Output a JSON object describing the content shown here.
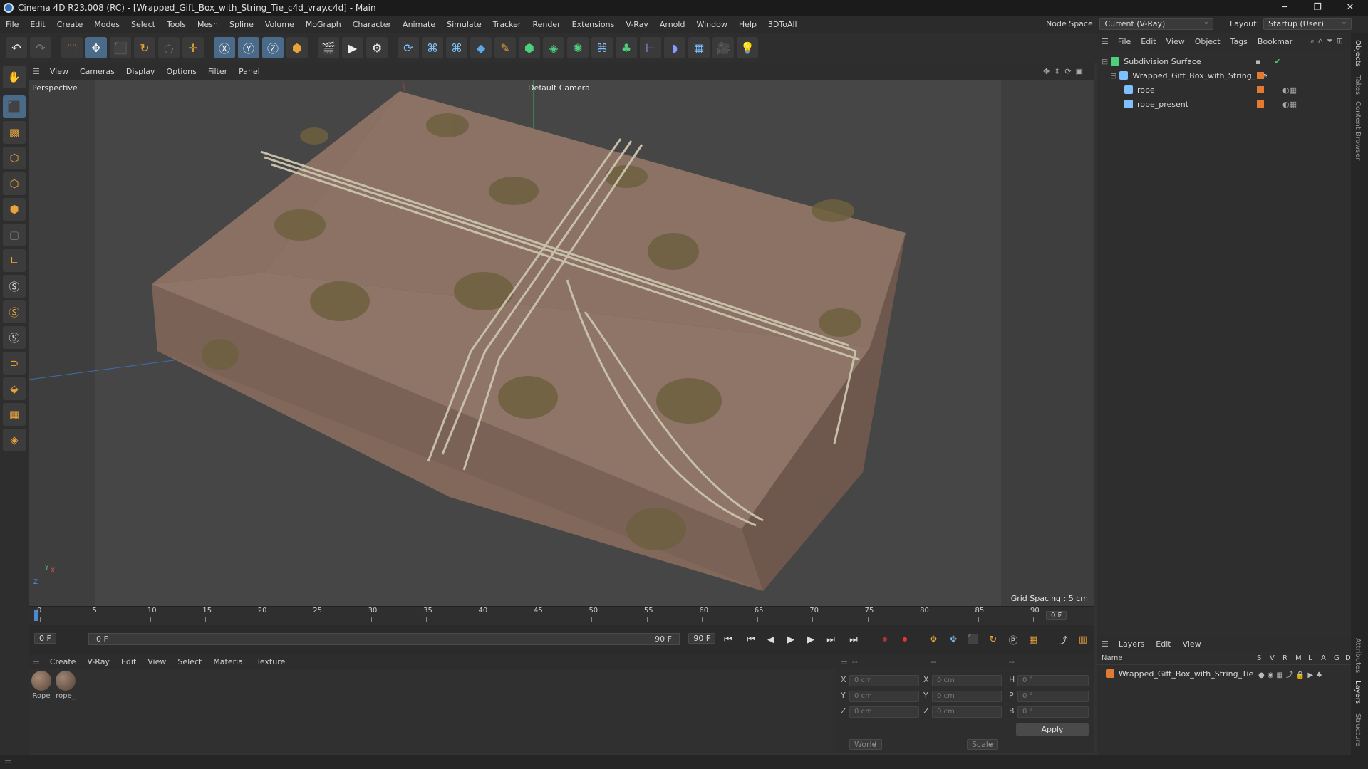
{
  "window": {
    "title": "Cinema 4D R23.008 (RC) - [Wrapped_Gift_Box_with_String_Tie_c4d_vray.c4d] - Main",
    "minimize": "─",
    "restore": "❐",
    "close": "✕"
  },
  "menu": {
    "items": [
      "File",
      "Edit",
      "Create",
      "Modes",
      "Select",
      "Tools",
      "Mesh",
      "Spline",
      "Volume",
      "MoGraph",
      "Character",
      "Animate",
      "Simulate",
      "Tracker",
      "Render",
      "Extensions",
      "V-Ray",
      "Arnold",
      "Window",
      "Help",
      "3DToAll"
    ],
    "node_space_label": "Node Space:",
    "node_space_value": "Current (V-Ray)",
    "layout_label": "Layout:",
    "layout_value": "Startup (User)"
  },
  "viewport": {
    "menu": [
      "View",
      "Cameras",
      "Display",
      "Options",
      "Filter",
      "Panel"
    ],
    "label": "Perspective",
    "camera": "Default Camera",
    "grid_spacing": "Grid Spacing : 5 cm",
    "axis_labels": {
      "y": "Y",
      "x": "X",
      "z": "Z"
    }
  },
  "timeline": {
    "ticks": [
      "0",
      "5",
      "10",
      "15",
      "20",
      "25",
      "30",
      "35",
      "40",
      "45",
      "50",
      "55",
      "60",
      "65",
      "70",
      "75",
      "80",
      "85",
      "90"
    ],
    "current_frame_field": "0 F",
    "start_field": "0 F",
    "range_start": "0 F",
    "range_end": "90 F",
    "end_field": "90 F",
    "end_field2": "90 F"
  },
  "material_panel": {
    "menu": [
      "Create",
      "V-Ray",
      "Edit",
      "View",
      "Select",
      "Material",
      "Texture"
    ],
    "materials": [
      {
        "name": "Rope"
      },
      {
        "name": "rope_"
      }
    ]
  },
  "coords": {
    "headers": [
      "--",
      "--",
      "--"
    ],
    "rows": [
      {
        "a_label": "X",
        "a_value": "0 cm",
        "b_label": "X",
        "b_value": "0 cm",
        "c_label": "H",
        "c_value": "0 °"
      },
      {
        "a_label": "Y",
        "a_value": "0 cm",
        "b_label": "Y",
        "b_value": "0 cm",
        "c_label": "P",
        "c_value": "0 °"
      },
      {
        "a_label": "Z",
        "a_value": "0 cm",
        "b_label": "Z",
        "b_value": "0 cm",
        "c_label": "B",
        "c_value": "0 °"
      }
    ],
    "space": "World",
    "mode": "Scale",
    "apply": "Apply"
  },
  "objects": {
    "menu": [
      "File",
      "Edit",
      "View",
      "Object",
      "Tags",
      "Bookmar"
    ],
    "tree": [
      {
        "name": "Subdivision Surface",
        "indent": 0
      },
      {
        "name": "Wrapped_Gift_Box_with_String_Tie",
        "indent": 1
      },
      {
        "name": "rope",
        "indent": 2
      },
      {
        "name": "rope_present",
        "indent": 2
      }
    ]
  },
  "layers": {
    "menu": [
      "Layers",
      "Edit",
      "View"
    ],
    "columns": [
      "Name",
      "S",
      "V",
      "R",
      "M",
      "L",
      "A",
      "G",
      "D"
    ],
    "rows": [
      {
        "name": "Wrapped_Gift_Box_with_String_Tie"
      }
    ]
  },
  "side_tabs": [
    "Objects",
    "Takes",
    "Content Browser",
    "Attributes",
    "Layers",
    "Structure"
  ],
  "colors": {
    "accent_orange": "#e27a31",
    "selection_blue": "#4a6a8a"
  }
}
